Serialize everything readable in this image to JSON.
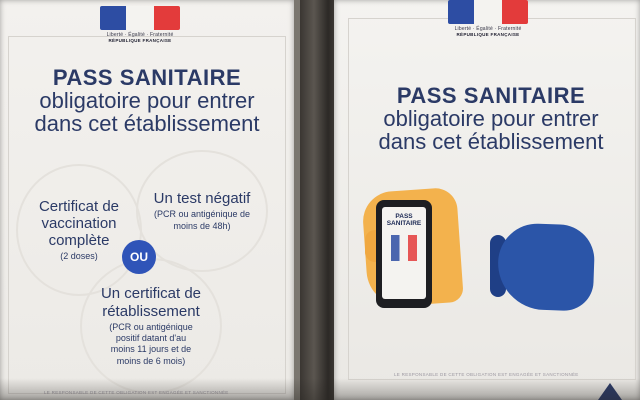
{
  "left_poster": {
    "logo_motto": "Liberté · Égalité · Fraternité",
    "logo_republic": "RÉPUBLIQUE FRANÇAISE",
    "title_line1": "PASS SANITAIRE",
    "title_line2": "obligatoire pour entrer",
    "title_line3": "dans cet établissement",
    "circle_vaccination": {
      "big_lines": [
        "Certificat de",
        "vaccination",
        "complète"
      ],
      "small": "(2 doses)"
    },
    "circle_test": {
      "big": "Un test négatif",
      "small_lines": [
        "(PCR ou antigénique de",
        "moins de 48h)"
      ]
    },
    "ou_label": "OU",
    "circle_recovery": {
      "big_lines": [
        "Un certificat de",
        "rétablissement"
      ],
      "small_lines": [
        "(PCR ou antigénique",
        "positif datant d'au",
        "moins 11 jours et de",
        "moins de 6 mois)"
      ]
    },
    "footer": "LE RESPONSABLE DE CETTE OBLIGATION EST ENGAGÉE ET SANCTIONNÉE"
  },
  "right_poster": {
    "logo_motto": "Liberté · Égalité · Fraternité",
    "logo_republic": "RÉPUBLIQUE FRANÇAISE",
    "title_line1": "PASS SANITAIRE",
    "title_line2": "obligatoire pour entrer",
    "title_line3": "dans cet établissement",
    "phone_label_line1": "PASS",
    "phone_label_line2": "SANITAIRE",
    "footer": "LE RESPONSABLE DE CETTE OBLIGATION EST ENGAGÉE ET SANCTIONNÉE"
  },
  "colors": {
    "navy_text": "#2b3a66",
    "ou_badge": "#2f54b8",
    "flag_blue": "#2d4da3",
    "flag_red": "#e33b3b",
    "mask_blue": "#2b55a8",
    "hand_orange": "#f3b24d"
  }
}
